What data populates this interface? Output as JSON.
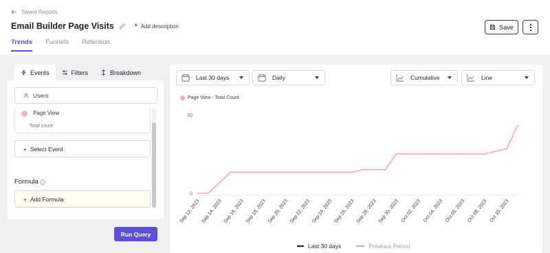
{
  "header": {
    "back_label": "Saved Reports",
    "title": "Email Builder Page Visits",
    "add_description": "Add description",
    "save_label": "Save",
    "tabs": [
      "Trends",
      "Funnels",
      "Retention"
    ]
  },
  "left_panel": {
    "tabs": [
      "Events",
      "Filters",
      "Breakdown"
    ],
    "users_label": "Users",
    "event": {
      "name": "Page View",
      "sub": "Total count"
    },
    "select_event": "Select Event",
    "formula_label": "Formula",
    "add_formula": "Add Formula",
    "run_query": "Run Query"
  },
  "controls": {
    "date_range": "Last 30 days",
    "interval": "Daily",
    "metric": "Cumulative",
    "chart_type": "Line"
  },
  "legend": {
    "current": "Last 30 days",
    "previous": "Previous Period"
  },
  "colors": {
    "accent": "#5b4fd6",
    "series": "#f4a7b9"
  },
  "chart_data": {
    "type": "line",
    "title": "",
    "y_ticks": [
      0,
      30
    ],
    "ylim": [
      0,
      30
    ],
    "x_tick_labels": [
      "Sep 12, 2023",
      "Sep 14, 2023",
      "Sep 16, 2023",
      "Sep 18, 2023",
      "Sep 20, 2023",
      "Sep 22, 2023",
      "Sep 24, 2023",
      "Sep 26, 2023",
      "Sep 28, 2023",
      "Sep 30, 2023",
      "Oct 02, 2023",
      "Oct 04, 2023",
      "Oct 06, 2023",
      "Oct 08, 2023",
      "Oct 10, 2023"
    ],
    "series": [
      {
        "name": "Page View - Total Count",
        "x": [
          "Sep 12, 2023",
          "Sep 13, 2023",
          "Sep 14, 2023",
          "Sep 15, 2023",
          "Sep 16, 2023",
          "Sep 17, 2023",
          "Sep 18, 2023",
          "Sep 19, 2023",
          "Sep 20, 2023",
          "Sep 21, 2023",
          "Sep 22, 2023",
          "Sep 23, 2023",
          "Sep 24, 2023",
          "Sep 25, 2023",
          "Sep 26, 2023",
          "Sep 27, 2023",
          "Sep 28, 2023",
          "Sep 29, 2023",
          "Sep 30, 2023",
          "Oct 01, 2023",
          "Oct 02, 2023",
          "Oct 03, 2023",
          "Oct 04, 2023",
          "Oct 05, 2023",
          "Oct 06, 2023",
          "Oct 07, 2023",
          "Oct 08, 2023",
          "Oct 09, 2023",
          "Oct 10, 2023",
          "Oct 11, 2023"
        ],
        "values": [
          0,
          0,
          4,
          8,
          8,
          8,
          8,
          8,
          8,
          8,
          8,
          8,
          8,
          8,
          8,
          9,
          9,
          9,
          15,
          15,
          15,
          15,
          15,
          15,
          15,
          15,
          15,
          16,
          17,
          26
        ]
      }
    ]
  }
}
